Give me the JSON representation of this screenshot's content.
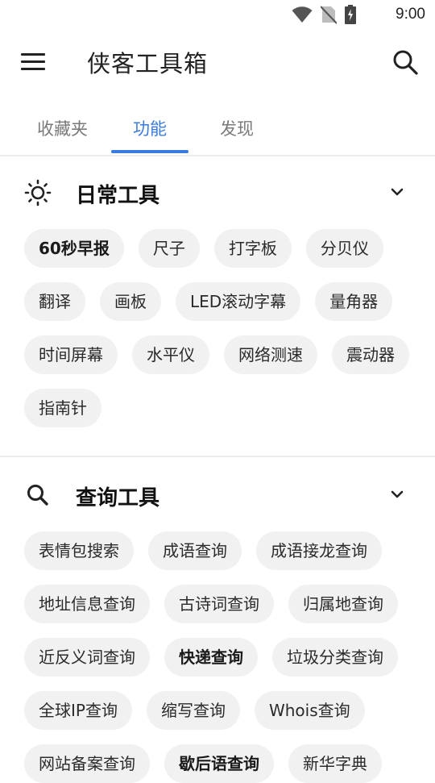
{
  "status_bar": {
    "time": "9:00",
    "icons": [
      "wifi-icon",
      "no-sim-icon",
      "battery-charging-icon"
    ]
  },
  "app_bar": {
    "title": "侠客工具箱",
    "icons": [
      "menu-icon",
      "search-icon"
    ]
  },
  "tabs": [
    {
      "label": "收藏夹",
      "active": false
    },
    {
      "label": "功能",
      "active": true
    },
    {
      "label": "发现",
      "active": false
    }
  ],
  "accent_color": "#3a7be0",
  "sections": [
    {
      "title": "日常工具",
      "icon": "sun-icon",
      "chips": [
        {
          "label": "60秒早报",
          "bold": true
        },
        {
          "label": "尺子",
          "bold": false
        },
        {
          "label": "打字板",
          "bold": false
        },
        {
          "label": "分贝仪",
          "bold": false
        },
        {
          "label": "翻译",
          "bold": false
        },
        {
          "label": "画板",
          "bold": false
        },
        {
          "label": "LED滚动字幕",
          "bold": false
        },
        {
          "label": "量角器",
          "bold": false
        },
        {
          "label": "时间屏幕",
          "bold": false
        },
        {
          "label": "水平仪",
          "bold": false
        },
        {
          "label": "网络测速",
          "bold": false
        },
        {
          "label": "震动器",
          "bold": false
        },
        {
          "label": "指南针",
          "bold": false
        }
      ]
    },
    {
      "title": "查询工具",
      "icon": "search-icon",
      "chips": [
        {
          "label": "表情包搜索",
          "bold": false
        },
        {
          "label": "成语查询",
          "bold": false
        },
        {
          "label": "成语接龙查询",
          "bold": false
        },
        {
          "label": "地址信息查询",
          "bold": false
        },
        {
          "label": "古诗词查询",
          "bold": false
        },
        {
          "label": "归属地查询",
          "bold": false
        },
        {
          "label": "近反义词查询",
          "bold": false
        },
        {
          "label": "快递查询",
          "bold": true
        },
        {
          "label": "垃圾分类查询",
          "bold": false
        },
        {
          "label": "全球IP查询",
          "bold": false
        },
        {
          "label": "缩写查询",
          "bold": false
        },
        {
          "label": "Whois查询",
          "bold": false
        },
        {
          "label": "网站备案查询",
          "bold": false
        },
        {
          "label": "歇后语查询",
          "bold": true
        },
        {
          "label": "新华字典",
          "bold": false
        }
      ]
    }
  ]
}
